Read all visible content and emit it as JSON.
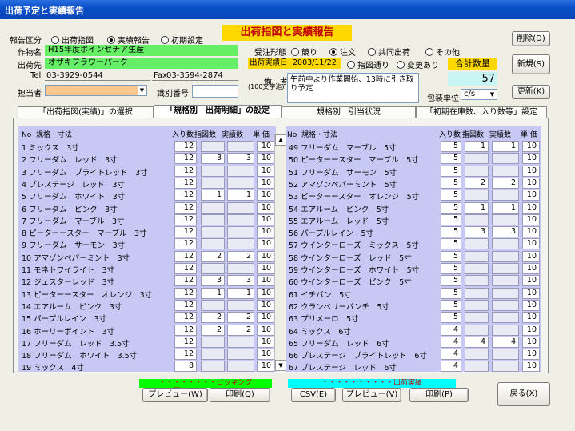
{
  "window_title": "出荷予定と実績報告",
  "report_type": {
    "label": "報告区分",
    "options": [
      "出荷指図",
      "実績報告",
      "初期設定"
    ],
    "selected": 1
  },
  "main_title": "出荷指図と実績報告",
  "crop": {
    "label": "作物名",
    "value": "H15年度ポインセチア生産"
  },
  "shipper": {
    "label": "出荷先",
    "value": "オザキフラワーパーク"
  },
  "tel": {
    "label": "Tel",
    "value": "03-3929-0544"
  },
  "fax": {
    "label": "Fax",
    "value": "03-3594-2874"
  },
  "person": {
    "label": "担当者",
    "value": ""
  },
  "id_number": {
    "label": "識別番号",
    "value": ""
  },
  "order_form": {
    "label": "受注形態",
    "options": [
      "競り",
      "注文",
      "共同出荷",
      "その他"
    ],
    "selected": 1
  },
  "ship_date": {
    "label": "出荷実績日",
    "value": "2003/11/22"
  },
  "instruction": {
    "options": [
      "指図通り",
      "変更あり"
    ],
    "selected": -1
  },
  "total": {
    "label": "合計数量",
    "value": "57"
  },
  "notes": {
    "label": "備　考",
    "sublabel": "(100文字迄)",
    "value": "午前中より作業開始、13時に引き取り予定"
  },
  "packing": {
    "label": "包装単位",
    "value": "c/s"
  },
  "buttons": {
    "delete": "削除(D)",
    "new": "新規(S)",
    "update": "更新(K)",
    "back": "戻る(X)"
  },
  "tabs": [
    "「出荷指図(実績)」の選択",
    "「規格別　出荷明細」の設定",
    "規格別　引当状況",
    "「初期在庫数、入り数等」設定"
  ],
  "active_tab": 1,
  "columns": {
    "no": "No",
    "spec": "規格・寸法",
    "qty": "入り数",
    "order": "指図数",
    "actual": "実績数",
    "price": "単 価"
  },
  "left_items": [
    {
      "name": "1 ミックス　3寸",
      "qty": "12",
      "order": "",
      "actual": "",
      "price": "10"
    },
    {
      "name": "2 フリーダム　レッド　3寸",
      "qty": "12",
      "order": "3",
      "actual": "3",
      "price": "10"
    },
    {
      "name": "3 フリーダム　ブライトレッド　3寸",
      "qty": "12",
      "order": "",
      "actual": "",
      "price": "10"
    },
    {
      "name": "4 プレステージ　レッド　3寸",
      "qty": "12",
      "order": "",
      "actual": "",
      "price": "10"
    },
    {
      "name": "5 フリーダム　ホワイト　3寸",
      "qty": "12",
      "order": "1",
      "actual": "1",
      "price": "10"
    },
    {
      "name": "6 フリーダム　ピンク　3寸",
      "qty": "12",
      "order": "",
      "actual": "",
      "price": "10"
    },
    {
      "name": "7 フリーダム　マーブル　3寸",
      "qty": "12",
      "order": "",
      "actual": "",
      "price": "10"
    },
    {
      "name": "8 ピーターースター　マーブル　3寸",
      "qty": "12",
      "order": "",
      "actual": "",
      "price": "10"
    },
    {
      "name": "9 フリーダム　サーモン　3寸",
      "qty": "12",
      "order": "",
      "actual": "",
      "price": "10"
    },
    {
      "name": "10 アマゾンペパーミント　3寸",
      "qty": "12",
      "order": "2",
      "actual": "2",
      "price": "10"
    },
    {
      "name": "11 モネトワイライト　3寸",
      "qty": "12",
      "order": "",
      "actual": "",
      "price": "10"
    },
    {
      "name": "12 ジェスターレッド　3寸",
      "qty": "12",
      "order": "3",
      "actual": "3",
      "price": "10"
    },
    {
      "name": "13 ピーターースター　オレンジ　3寸",
      "qty": "12",
      "order": "1",
      "actual": "1",
      "price": "10"
    },
    {
      "name": "14 エアルーム　ピンク　3寸",
      "qty": "12",
      "order": "",
      "actual": "",
      "price": "10"
    },
    {
      "name": "15 パープルレイン　3寸",
      "qty": "12",
      "order": "2",
      "actual": "2",
      "price": "10"
    },
    {
      "name": "16 ホーリーポイント　3寸",
      "qty": "12",
      "order": "2",
      "actual": "2",
      "price": "10"
    },
    {
      "name": "17 フリーダム　レッド　3.5寸",
      "qty": "12",
      "order": "",
      "actual": "",
      "price": "10"
    },
    {
      "name": "18 フリーダム　ホワイト　3.5寸",
      "qty": "12",
      "order": "",
      "actual": "",
      "price": "10"
    },
    {
      "name": "19 ミックス　4寸",
      "qty": "8",
      "order": "",
      "actual": "",
      "price": "10"
    }
  ],
  "right_items": [
    {
      "name": "49 フリーダム　マーブル　5寸",
      "qty": "5",
      "order": "1",
      "actual": "1",
      "price": "10"
    },
    {
      "name": "50 ピーターースター　マーブル　5寸",
      "qty": "5",
      "order": "",
      "actual": "",
      "price": "10"
    },
    {
      "name": "51 フリーダム　サーモン　5寸",
      "qty": "5",
      "order": "",
      "actual": "",
      "price": "10"
    },
    {
      "name": "52 アマゾンペパーミント　5寸",
      "qty": "5",
      "order": "2",
      "actual": "2",
      "price": "10"
    },
    {
      "name": "53 ピーターースター　オレンジ　5寸",
      "qty": "5",
      "order": "",
      "actual": "",
      "price": "10"
    },
    {
      "name": "54 エアルーム　ピンク　5寸",
      "qty": "5",
      "order": "1",
      "actual": "1",
      "price": "10"
    },
    {
      "name": "55 エアルーム　レッド　5寸",
      "qty": "5",
      "order": "",
      "actual": "",
      "price": "10"
    },
    {
      "name": "56 パープルレイン　5寸",
      "qty": "5",
      "order": "3",
      "actual": "3",
      "price": "10"
    },
    {
      "name": "57 ウインターローズ　ミックス　5寸",
      "qty": "5",
      "order": "",
      "actual": "",
      "price": "10"
    },
    {
      "name": "58 ウインターローズ　レッド　5寸",
      "qty": "5",
      "order": "",
      "actual": "",
      "price": "10"
    },
    {
      "name": "59 ウインターローズ　ホワイト　5寸",
      "qty": "5",
      "order": "",
      "actual": "",
      "price": "10"
    },
    {
      "name": "60 ウインターローズ　ピンク　5寸",
      "qty": "5",
      "order": "",
      "actual": "",
      "price": "10"
    },
    {
      "name": "61 イチバン　5寸",
      "qty": "5",
      "order": "",
      "actual": "",
      "price": "10"
    },
    {
      "name": "62 クランベリーパンチ　5寸",
      "qty": "5",
      "order": "",
      "actual": "",
      "price": "10"
    },
    {
      "name": "63 プリメーロ　5寸",
      "qty": "5",
      "order": "",
      "actual": "",
      "price": "10"
    },
    {
      "name": "64 ミックス　6寸",
      "qty": "4",
      "order": "",
      "actual": "",
      "price": "10"
    },
    {
      "name": "65 フリーダム　レッド　6寸",
      "qty": "4",
      "order": "4",
      "actual": "4",
      "price": "10"
    },
    {
      "name": "66 プレステージ　ブライトレッド　6寸",
      "qty": "4",
      "order": "",
      "actual": "",
      "price": "10"
    },
    {
      "name": "67 プレステージ　レッド　6寸",
      "qty": "4",
      "order": "",
      "actual": "",
      "price": "10"
    }
  ],
  "picking": {
    "label": "・・・・・・・・ピッキング票・・・・・・・・",
    "preview": "プレビュー(W)",
    "print": "印刷(Q)"
  },
  "shipping": {
    "label": "・・・・・・・・・・出荷実績書・・・・・・・・・・・",
    "csv": "CSV(E)",
    "preview": "プレビュー(V)",
    "print": "印刷(P)"
  }
}
